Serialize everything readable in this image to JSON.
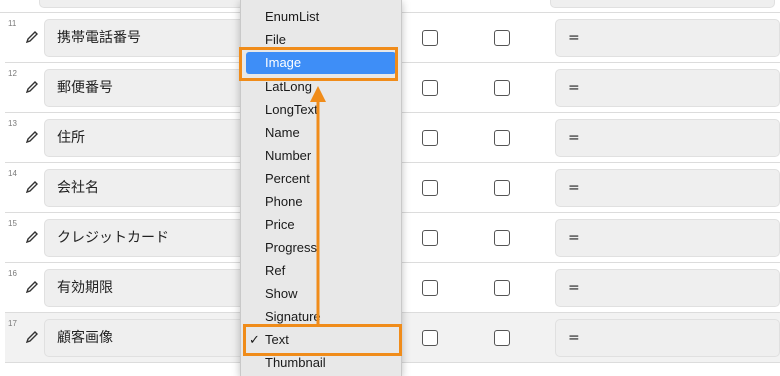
{
  "rows": [
    {
      "num": "11",
      "name": "携帯電話番号",
      "formula": "="
    },
    {
      "num": "12",
      "name": "郵便番号",
      "formula": "="
    },
    {
      "num": "13",
      "name": "住所",
      "formula": "="
    },
    {
      "num": "14",
      "name": "会社名",
      "formula": "="
    },
    {
      "num": "15",
      "name": "クレジットカード",
      "formula": "="
    },
    {
      "num": "16",
      "name": "有効期限",
      "formula": "="
    },
    {
      "num": "17",
      "name": "顧客画像",
      "formula": "="
    }
  ],
  "dropdown": {
    "items": [
      "EnumList",
      "File",
      "Image",
      "LatLong",
      "LongText",
      "Name",
      "Number",
      "Percent",
      "Phone",
      "Price",
      "Progress",
      "Ref",
      "Show",
      "Signature",
      "Text",
      "Thumbnail"
    ],
    "highlighted": "Image",
    "checked": "Text",
    "checkmark": "✓"
  },
  "colors": {
    "highlight": "#3e8ef7",
    "annotation": "#f08c1a"
  },
  "icons": {
    "edit": "pencil-icon"
  }
}
